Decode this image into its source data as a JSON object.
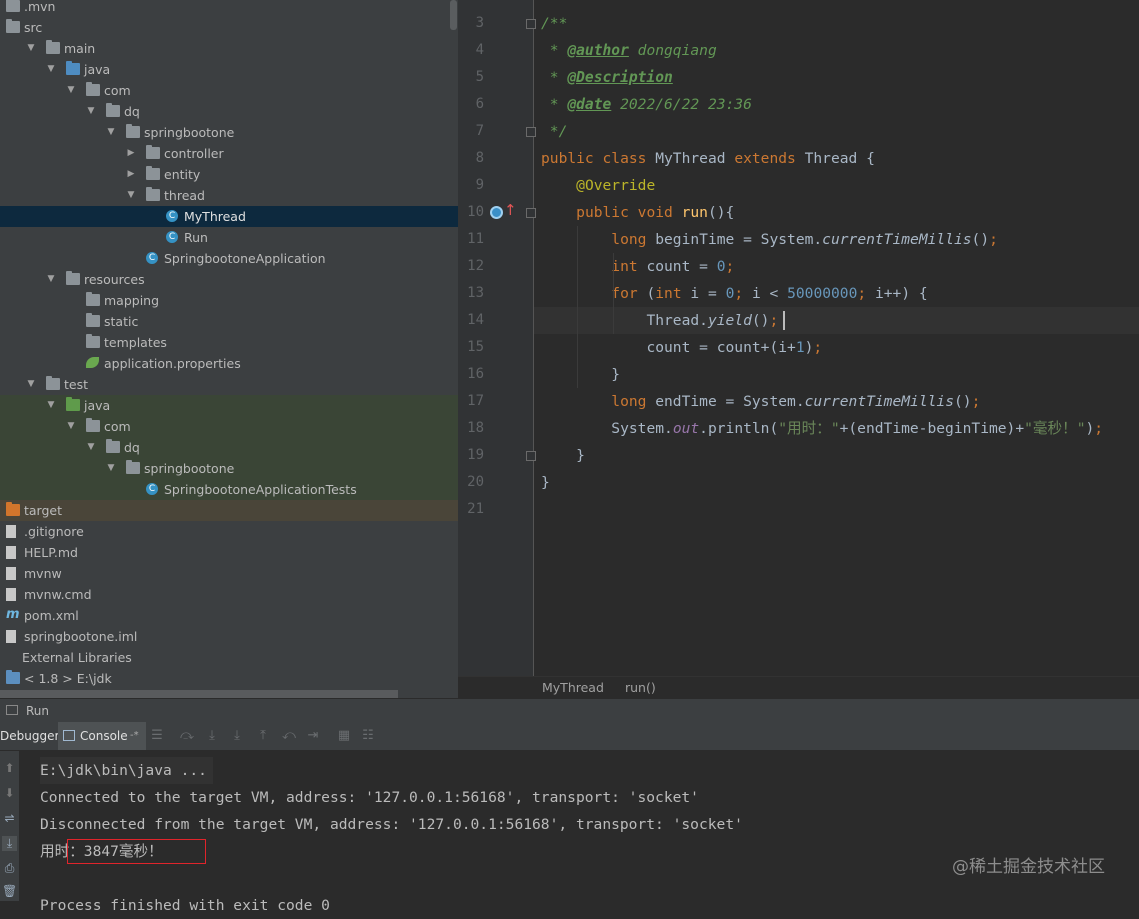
{
  "project_tree": [
    {
      "label": ".mvn",
      "depth": 0,
      "arrow": "",
      "icon": "folder-icon"
    },
    {
      "label": "src",
      "depth": 0,
      "arrow": "",
      "icon": "folder-icon"
    },
    {
      "label": "main",
      "depth": 1,
      "arrow": "▼",
      "icon": "folder-icon"
    },
    {
      "label": "java",
      "depth": 2,
      "arrow": "▼",
      "icon": "source-folder-icon"
    },
    {
      "label": "com",
      "depth": 3,
      "arrow": "▼",
      "icon": "package-icon"
    },
    {
      "label": "dq",
      "depth": 4,
      "arrow": "▼",
      "icon": "package-icon"
    },
    {
      "label": "springbootone",
      "depth": 5,
      "arrow": "▼",
      "icon": "package-icon"
    },
    {
      "label": "controller",
      "depth": 6,
      "arrow": "▶",
      "icon": "package-icon"
    },
    {
      "label": "entity",
      "depth": 6,
      "arrow": "▶",
      "icon": "package-icon"
    },
    {
      "label": "thread",
      "depth": 6,
      "arrow": "▼",
      "icon": "package-icon"
    },
    {
      "label": "MyThread",
      "depth": 7,
      "arrow": "",
      "icon": "class-icon",
      "selected": true
    },
    {
      "label": "Run",
      "depth": 7,
      "arrow": "",
      "icon": "class-icon"
    },
    {
      "label": "SpringbootoneApplication",
      "depth": 6,
      "arrow": "",
      "icon": "spring-class-icon"
    },
    {
      "label": "resources",
      "depth": 2,
      "arrow": "▼",
      "icon": "resources-folder-icon"
    },
    {
      "label": "mapping",
      "depth": 3,
      "arrow": "",
      "icon": "folder-icon"
    },
    {
      "label": "static",
      "depth": 3,
      "arrow": "",
      "icon": "folder-icon"
    },
    {
      "label": "templates",
      "depth": 3,
      "arrow": "",
      "icon": "folder-icon"
    },
    {
      "label": "application.properties",
      "depth": 3,
      "arrow": "",
      "icon": "spring-leaf-icon"
    },
    {
      "label": "test",
      "depth": 1,
      "arrow": "▼",
      "icon": "folder-icon"
    },
    {
      "label": "java",
      "depth": 2,
      "arrow": "▼",
      "icon": "test-folder-icon",
      "test": true
    },
    {
      "label": "com",
      "depth": 3,
      "arrow": "▼",
      "icon": "package-icon",
      "test": true
    },
    {
      "label": "dq",
      "depth": 4,
      "arrow": "▼",
      "icon": "package-icon",
      "test": true
    },
    {
      "label": "springbootone",
      "depth": 5,
      "arrow": "▼",
      "icon": "package-icon",
      "test": true
    },
    {
      "label": "SpringbootoneApplicationTests",
      "depth": 6,
      "arrow": "",
      "icon": "spring-class-icon",
      "test": true
    },
    {
      "label": "target",
      "depth": 0,
      "arrow": "",
      "icon": "excluded-folder-icon",
      "excluded": true
    },
    {
      "label": ".gitignore",
      "depth": 0,
      "arrow": "",
      "icon": "file-icon"
    },
    {
      "label": "HELP.md",
      "depth": 0,
      "arrow": "",
      "icon": "markdown-file-icon"
    },
    {
      "label": "mvnw",
      "depth": 0,
      "arrow": "",
      "icon": "file-icon"
    },
    {
      "label": "mvnw.cmd",
      "depth": 0,
      "arrow": "",
      "icon": "file-icon"
    },
    {
      "label": "pom.xml",
      "depth": 0,
      "arrow": "",
      "icon": "maven-icon"
    },
    {
      "label": "springbootone.iml",
      "depth": 0,
      "arrow": "",
      "icon": "file-icon"
    },
    {
      "label": "External Libraries",
      "depth": -1,
      "arrow": "",
      "icon": ""
    },
    {
      "label": "< 1.8 >  E:\\jdk",
      "depth": 0,
      "arrow": "",
      "icon": "jdk-icon"
    }
  ],
  "editor": {
    "line_numbers": [
      "3",
      "4",
      "5",
      "6",
      "7",
      "8",
      "9",
      "10",
      "11",
      "12",
      "13",
      "14",
      "15",
      "16",
      "17",
      "18",
      "19",
      "20",
      "21"
    ],
    "lines": [
      [
        {
          "t": "/**",
          "c": "cm"
        }
      ],
      [
        {
          "t": " * ",
          "c": "cm"
        },
        {
          "t": "@author",
          "c": "tag"
        },
        {
          "t": " dongqiang",
          "c": "cm"
        }
      ],
      [
        {
          "t": " * ",
          "c": "cm"
        },
        {
          "t": "@Description",
          "c": "tag"
        }
      ],
      [
        {
          "t": " * ",
          "c": "cm"
        },
        {
          "t": "@date",
          "c": "tag"
        },
        {
          "t": " 2022/6/22 23:36",
          "c": "cm"
        }
      ],
      [
        {
          "t": " */",
          "c": "cm"
        }
      ],
      [
        {
          "t": "public class ",
          "c": "kw"
        },
        {
          "t": "MyThread ",
          "c": ""
        },
        {
          "t": "extends ",
          "c": "kw"
        },
        {
          "t": "Thread {",
          "c": ""
        }
      ],
      [
        {
          "t": "    ",
          "c": ""
        },
        {
          "t": "@Override",
          "c": "ann"
        }
      ],
      [
        {
          "t": "    ",
          "c": ""
        },
        {
          "t": "public void ",
          "c": "kw"
        },
        {
          "t": "run",
          "c": "fn"
        },
        {
          "t": "(){",
          "c": ""
        }
      ],
      [
        {
          "t": "        ",
          "c": ""
        },
        {
          "t": "long ",
          "c": "kw"
        },
        {
          "t": "beginTime = System.",
          "c": ""
        },
        {
          "t": "currentTimeMillis",
          "c": "st-it"
        },
        {
          "t": "()",
          "c": ""
        },
        {
          "t": ";",
          "c": "kw"
        }
      ],
      [
        {
          "t": "        ",
          "c": ""
        },
        {
          "t": "int ",
          "c": "kw"
        },
        {
          "t": "count = ",
          "c": ""
        },
        {
          "t": "0",
          "c": "num"
        },
        {
          "t": ";",
          "c": "kw"
        }
      ],
      [
        {
          "t": "        ",
          "c": ""
        },
        {
          "t": "for ",
          "c": "kw"
        },
        {
          "t": "(",
          "c": ""
        },
        {
          "t": "int ",
          "c": "kw"
        },
        {
          "t": "i = ",
          "c": ""
        },
        {
          "t": "0",
          "c": "num"
        },
        {
          "t": "; ",
          "c": "kw"
        },
        {
          "t": "i < ",
          "c": ""
        },
        {
          "t": "50000000",
          "c": "num"
        },
        {
          "t": "; ",
          "c": "kw"
        },
        {
          "t": "i++) {",
          "c": ""
        }
      ],
      [
        {
          "t": "            ",
          "c": ""
        },
        {
          "t": "Thread.",
          "c": ""
        },
        {
          "t": "yield",
          "c": "st-it"
        },
        {
          "t": "()",
          "c": ""
        },
        {
          "t": ";",
          "c": "kw"
        }
      ],
      [
        {
          "t": "            ",
          "c": ""
        },
        {
          "t": "count = count+(i+",
          "c": ""
        },
        {
          "t": "1",
          "c": "num"
        },
        {
          "t": ")",
          "c": ""
        },
        {
          "t": ";",
          "c": "kw"
        }
      ],
      [
        {
          "t": "        }",
          "c": ""
        }
      ],
      [
        {
          "t": "        ",
          "c": ""
        },
        {
          "t": "long ",
          "c": "kw"
        },
        {
          "t": "endTime = System.",
          "c": ""
        },
        {
          "t": "currentTimeMillis",
          "c": "st-it"
        },
        {
          "t": "()",
          "c": ""
        },
        {
          "t": ";",
          "c": "kw"
        }
      ],
      [
        {
          "t": "        ",
          "c": ""
        },
        {
          "t": "System.",
          "c": ""
        },
        {
          "t": "out",
          "c": "fld"
        },
        {
          "t": ".println(",
          "c": ""
        },
        {
          "t": "\"用时：\"",
          "c": "str"
        },
        {
          "t": "+(endTime-beginTime)+",
          "c": ""
        },
        {
          "t": "\"毫秒！\"",
          "c": "str"
        },
        {
          "t": ")",
          "c": ""
        },
        {
          "t": ";",
          "c": "kw"
        }
      ],
      [
        {
          "t": "    }",
          "c": ""
        }
      ],
      [
        {
          "t": "}",
          "c": ""
        }
      ],
      [
        {
          "t": "",
          "c": ""
        }
      ]
    ],
    "breadcrumb": [
      "MyThread",
      "run()"
    ]
  },
  "run_panel": {
    "title": "Run",
    "tabs": {
      "debugger": "Debugger",
      "console": "Console"
    },
    "console_lines": [
      "E:\\jdk\\bin\\java ...",
      "Connected to the target VM, address: '127.0.0.1:56168', transport: 'socket'",
      "Disconnected from the target VM, address: '127.0.0.1:56168', transport: 'socket'",
      "用时：3847毫秒！",
      "",
      "Process finished with exit code 0"
    ]
  },
  "watermark": "@稀土掘金技术社区",
  "colors": {
    "keyword": "#cc7832",
    "comment": "#629755",
    "string": "#6a8759",
    "number": "#6897bb",
    "annotation": "#bbb529",
    "method": "#ffc66d",
    "highlight_box": "#e0242b"
  }
}
